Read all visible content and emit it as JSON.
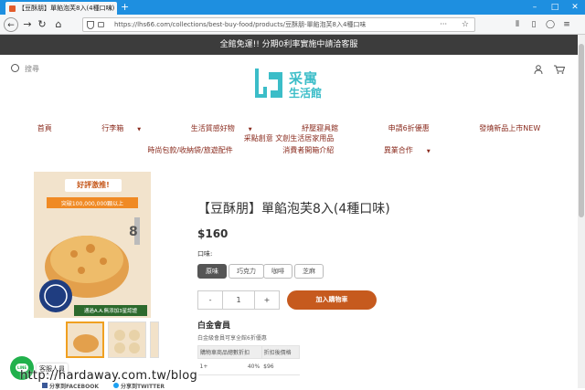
{
  "browser": {
    "tab_title": "【豆酥朋】單餡泡芙8入(4種口味)",
    "tab_close": "×",
    "new_tab": "+",
    "url": "https://lhs66.com/collections/best-buy-food/products/豆酥朋-單餡泡芙8入4種口味",
    "url_menu": "···",
    "back": "←",
    "forward": "→",
    "reload": "↻",
    "home": "⌂"
  },
  "promo_bar": "全館免運!! 分期0利率實施中請洽客服",
  "header": {
    "search_placeholder": "搜尋",
    "logo_line1": "采寓",
    "logo_line2": "生活館"
  },
  "menu_row1": [
    {
      "label": "首頁",
      "has_dropdown": false
    },
    {
      "label": "行李箱",
      "has_dropdown": true
    },
    {
      "label": "生活質感好物",
      "has_dropdown": true
    },
    {
      "label": "紓壓寢具館",
      "has_dropdown": false
    },
    {
      "label": "申請6折優惠",
      "has_dropdown": false
    },
    {
      "label": "發燒新品上市NEW",
      "has_dropdown": false
    },
    {
      "label": "采點創意 文創生活居家用品",
      "has_dropdown": false
    }
  ],
  "menu_row2": [
    {
      "label": "時尚包款/收納袋/旅遊配件",
      "has_dropdown": false
    },
    {
      "label": "消費者開箱介紹",
      "has_dropdown": false
    },
    {
      "label": "異業合作",
      "has_dropdown": true
    }
  ],
  "product_image": {
    "banner": "好評激推!",
    "sold": "突破100,000,000顆以上",
    "badge_num": "8",
    "bottom_note": "通過A.A.無添加3星認證"
  },
  "product": {
    "title": "【豆酥朋】單餡泡芙8入(4種口味)",
    "price": "$160",
    "flavor_label": "口味:",
    "flavors": [
      "原味",
      "巧克力",
      "咖啡",
      "芝麻"
    ],
    "selected_flavor": 0,
    "qty_minus": "-",
    "qty_value": "1",
    "qty_plus": "+",
    "add_to_cart": "加入購物車"
  },
  "membership": {
    "title": "白金會員",
    "subtitle": "白金級會員可享全館6折優惠",
    "table_headers": [
      "購物車商品總數折扣",
      "折扣後價格"
    ],
    "rows": [
      [
        "1+",
        "40%",
        "$96"
      ]
    ]
  },
  "chat": {
    "label": "客服人員",
    "icon_text": "LINE"
  },
  "share": {
    "facebook": "分享到FACEBOOK",
    "twitter": "分享到TWITTER"
  },
  "watermark": "http://hardaway.com.tw/blog",
  "colors": {
    "tabbar": "#1e8fe0",
    "promo": "#3c3c3c",
    "menu_text": "#8a2b1e",
    "logo": "#3bbdc8",
    "add_to_cart": "#c65a1e",
    "line_green": "#21b14c"
  }
}
